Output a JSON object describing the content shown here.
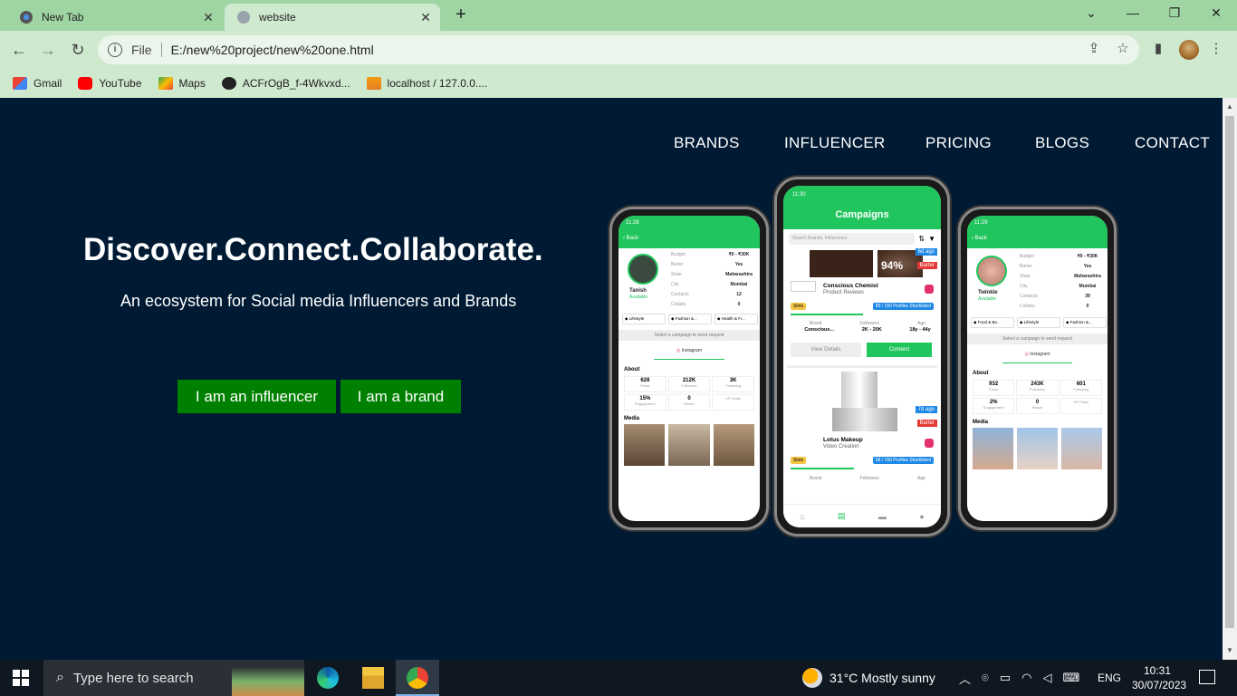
{
  "browser": {
    "tabs": [
      {
        "title": "New Tab",
        "active": false
      },
      {
        "title": "website",
        "active": true
      }
    ],
    "new_tab_glyph": "+",
    "address": {
      "scheme_label": "File",
      "url": "E:/new%20project/new%20one.html"
    },
    "bookmarks": [
      {
        "label": "Gmail",
        "icon": "gmail-icon"
      },
      {
        "label": "YouTube",
        "icon": "youtube-icon"
      },
      {
        "label": "Maps",
        "icon": "maps-icon"
      },
      {
        "label": "ACFrOgB_f-4Wkvxd...",
        "icon": "globe-icon"
      },
      {
        "label": "localhost / 127.0.0....",
        "icon": "phpmyadmin-icon"
      }
    ]
  },
  "site": {
    "nav": [
      "BRANDS",
      "INFLUENCER",
      "PRICING",
      "BLOGS",
      "CONTACT"
    ],
    "hero_title": "Discover.Connect.Collaborate.",
    "hero_subtitle": "An ecosystem for Social media Influencers and Brands",
    "cta_influencer": "I am an influencer",
    "cta_brand": "I am a brand"
  },
  "phones": {
    "left": {
      "time": "11:28",
      "back": "Back",
      "name": "Tanish",
      "status": "Available",
      "fields": [
        [
          "Budget",
          "₹0 - ₹30K"
        ],
        [
          "Barter",
          "Yes"
        ],
        [
          "State",
          "Maharashtra"
        ],
        [
          "City",
          "Mumbai"
        ],
        [
          "Contacts",
          "12"
        ],
        [
          "Collabs",
          "0"
        ]
      ],
      "tags": [
        "Lifestyle",
        "Fashion &...",
        "Health & Fi..."
      ],
      "select_campaign": "Select a campaign to send request",
      "platform": "Instagram",
      "about": "About",
      "stats": [
        [
          "628",
          "Posts"
        ],
        [
          "212K",
          "Followers"
        ],
        [
          "3K",
          "Following"
        ],
        [
          "15%",
          "Engagement"
        ],
        [
          "0",
          "Reach"
        ],
        [
          "",
          "KPI Stats"
        ]
      ],
      "media": "Media"
    },
    "center": {
      "time": "11:30",
      "header": "Campaigns",
      "search_placeholder": "Search Brands, Influencers",
      "card1": {
        "brand": "Conscious Chemist",
        "sub": "Product Reviews",
        "ago": "6d ago",
        "barter": "Barter",
        "percent": "94%",
        "slots": "Slots",
        "shortlisted": "80 / 150 Profiles Shortlisted",
        "brand_label": "Brand",
        "brand_val": "Conscious...",
        "followers_label": "Followers",
        "followers_val": "2K - 20K",
        "age_label": "Age",
        "age_val": "18y - 44y",
        "view": "View Details",
        "connect": "Connect"
      },
      "card2": {
        "brand": "Lotus Makeup",
        "sub": "Video Creation",
        "ago": "7d ago",
        "barter": "Barter",
        "slots": "Slots",
        "shortlisted": "68 / 150 Profiles Shortlisted",
        "brand_label": "Brand",
        "followers_label": "Followers",
        "age_label": "Age"
      }
    },
    "right": {
      "time": "11:29",
      "back": "Back",
      "name": "Twinkle",
      "status": "Available",
      "fields": [
        [
          "Budget",
          "₹0 - ₹30K"
        ],
        [
          "Barter",
          "Yes"
        ],
        [
          "State",
          "Maharashtra"
        ],
        [
          "City",
          "Mumbai"
        ],
        [
          "Contacts",
          "39"
        ],
        [
          "Collabs",
          "0"
        ]
      ],
      "tags": [
        "Food & Be...",
        "Lifestyle",
        "Fashion &..."
      ],
      "select_campaign": "Select a campaign to send request",
      "platform": "Instagram",
      "about": "About",
      "stats": [
        [
          "932",
          "Posts"
        ],
        [
          "243K",
          "Followers"
        ],
        [
          "601",
          "Following"
        ],
        [
          "2%",
          "Engagement"
        ],
        [
          "0",
          "Reach"
        ],
        [
          "",
          "KPI Stats"
        ]
      ],
      "media": "Media"
    }
  },
  "taskbar": {
    "search_placeholder": "Type here to search",
    "weather": "31°C  Mostly sunny",
    "lang": "ENG",
    "time": "10:31",
    "date": "30/07/2023"
  },
  "colors": {
    "page_bg": "#001a33",
    "cta": "#008000",
    "app_green": "#21c55d",
    "chrome": "#9fd5a3"
  }
}
